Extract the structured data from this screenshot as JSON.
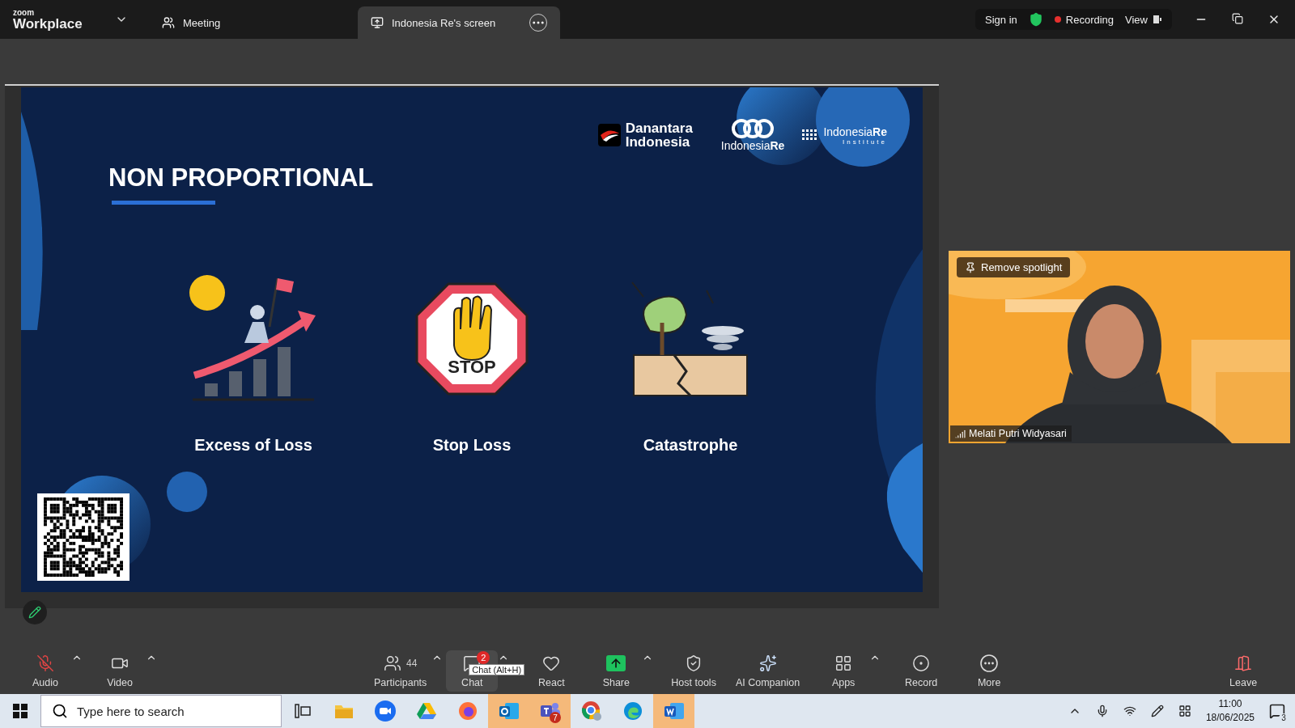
{
  "title_bar": {
    "brand_small": "zoom",
    "brand": "Workplace",
    "tabs": [
      {
        "label": "Meeting",
        "selected": false
      },
      {
        "label": "Indonesia Re's screen",
        "selected": true
      }
    ],
    "sign_in": "Sign in",
    "recording": "Recording",
    "view": "View"
  },
  "slide": {
    "logos": [
      {
        "kind": "danantara",
        "text": "Danantara Indonesia"
      },
      {
        "kind": "indonesiare",
        "text": "Indonesia**Re**"
      },
      {
        "kind": "institute",
        "text": "Indonesia**Re**",
        "subtext": "Institute"
      }
    ],
    "title": "NON PROPORTIONAL",
    "items": [
      {
        "kind": "growth",
        "label": "Excess of Loss"
      },
      {
        "kind": "stop",
        "label": "Stop Loss",
        "sign_text": "STOP"
      },
      {
        "kind": "disaster",
        "label": "Catastrophe"
      }
    ]
  },
  "video": {
    "kind": "picture",
    "spotlight_button": "Remove spotlight",
    "participant": "Melati Putri Widyasari"
  },
  "toolbar": [
    {
      "kind": "mic",
      "label": "Audio",
      "caret": true,
      "muted": true
    },
    {
      "kind": "video",
      "label": "Video",
      "caret": true
    },
    {
      "kind": "participants",
      "label": "Participants",
      "count": "44",
      "caret": true
    },
    {
      "kind": "chat",
      "label": "Chat",
      "badge": "2",
      "caret": true,
      "tooltip": "Chat (Alt+H)"
    },
    {
      "kind": "react",
      "label": "React",
      "caret": false
    },
    {
      "kind": "share",
      "label": "Share",
      "caret": true
    },
    {
      "kind": "host",
      "label": "Host tools",
      "caret": false
    },
    {
      "kind": "ai",
      "label": "AI Companion",
      "caret": false
    },
    {
      "kind": "apps",
      "label": "Apps",
      "caret": true
    },
    {
      "kind": "record",
      "label": "Record",
      "caret": false
    },
    {
      "kind": "more",
      "label": "More",
      "caret": false
    },
    {
      "kind": "leave",
      "label": "Leave",
      "caret": false
    }
  ],
  "taskbar": {
    "search_placeholder": "Type here to search",
    "apps": [
      {
        "kind": "taskview",
        "highlighted": false
      },
      {
        "kind": "files",
        "highlighted": false
      },
      {
        "kind": "zoom",
        "highlighted": false
      },
      {
        "kind": "drive",
        "highlighted": false
      },
      {
        "kind": "firefox",
        "highlighted": false
      },
      {
        "kind": "outlook",
        "highlighted": true
      },
      {
        "kind": "teams",
        "highlighted": true,
        "badge": "7"
      },
      {
        "kind": "chrome",
        "highlighted": false
      },
      {
        "kind": "edge",
        "highlighted": false
      },
      {
        "kind": "word",
        "highlighted": true
      }
    ],
    "time": "11:00",
    "date": "18/06/2025",
    "notifications": "3"
  }
}
